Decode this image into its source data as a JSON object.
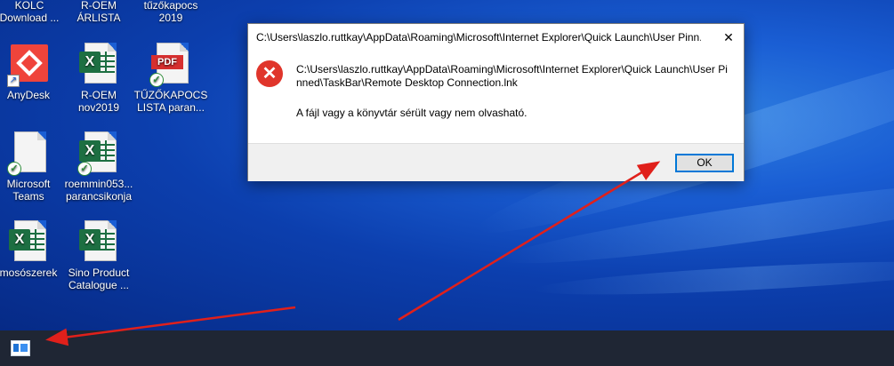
{
  "desktop": {
    "top_partial_labels": [
      {
        "line1": "KOLC",
        "line2": "Download ..."
      },
      {
        "line1": "R-OEM",
        "line2": "ÁRLISTA"
      },
      {
        "line1": "tűzőkapocs",
        "line2": "2019"
      }
    ],
    "icons": [
      {
        "line1": "AnyDesk",
        "line2": "",
        "icon": "anydesk-icon"
      },
      {
        "line1": "R-OEM",
        "line2": "nov2019",
        "icon": "excel-icon"
      },
      {
        "line1": "TŰZŐKAPOCS",
        "line2": "LISTA paran...",
        "icon": "pdf-icon",
        "badge_text": "PDF"
      },
      {
        "line1": "Microsoft",
        "line2": "Teams",
        "icon": "file-icon"
      },
      {
        "line1": "roemmin053...",
        "line2": "parancsikonja",
        "icon": "excel-icon"
      },
      {
        "line1": "mosószerek",
        "line2": "",
        "icon": "excel-icon"
      },
      {
        "line1": "Sino Product",
        "line2": "Catalogue ...",
        "icon": "excel-icon"
      }
    ],
    "excel_badge": "X"
  },
  "dialog": {
    "title": "C:\\Users\\laszlo.ruttkay\\AppData\\Roaming\\Microsoft\\Internet Explorer\\Quick Launch\\User Pinn...",
    "close_glyph": "✕",
    "error_glyph": "✕",
    "message": "C:\\Users\\laszlo.ruttkay\\AppData\\Roaming\\Microsoft\\Internet Explorer\\Quick Launch\\User Pinned\\TaskBar\\Remote Desktop Connection.lnk",
    "detail": "A fájl vagy a könyvtár sérült vagy nem olvasható.",
    "ok_label": "OK"
  },
  "taskbar": {
    "pinned_icon": "remote-desktop-icon"
  },
  "colors": {
    "annotation_arrow": "#e0201b",
    "desktop_bg": "#0c3fae",
    "taskbar_bg": "#1f2634",
    "error_red": "#e0352b",
    "button_focus": "#0078d7"
  }
}
